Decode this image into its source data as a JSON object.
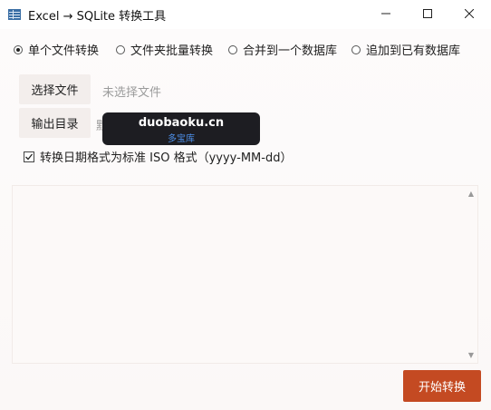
{
  "window": {
    "title": "Excel → SQLite 转换工具",
    "icon": "table-app-icon"
  },
  "modes": [
    {
      "label": "单个文件转换",
      "selected": true
    },
    {
      "label": "文件夹批量转换",
      "selected": false
    },
    {
      "label": "合并到一个数据库",
      "selected": false
    },
    {
      "label": "追加到已有数据库",
      "selected": false
    }
  ],
  "file": {
    "choose_label": "选择文件",
    "status": "未选择文件"
  },
  "output": {
    "choose_label": "输出目录",
    "status": "默"
  },
  "options": {
    "date_format_label": "转换日期格式为标准 ISO 格式（yyyy-MM-dd）",
    "date_format_checked": true
  },
  "log": {
    "text": ""
  },
  "actions": {
    "start_label": "开始转换",
    "start_color": "#c44a22"
  },
  "watermark": {
    "line1": "duobaoku.cn",
    "line2": "多宝库"
  }
}
